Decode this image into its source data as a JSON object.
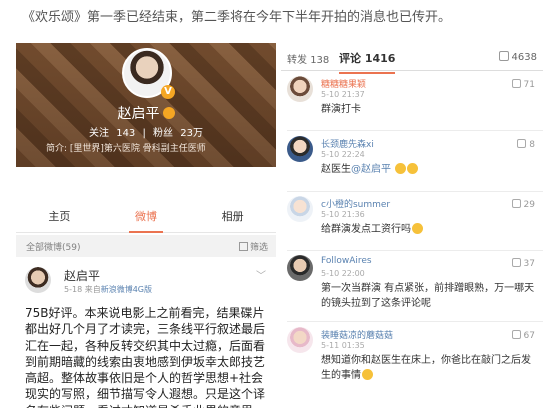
{
  "caption": "《欢乐颂》第一季已经结束，第二季将在今年下半年开拍的消息也已传开。",
  "profile": {
    "name": "赵启平",
    "stats": {
      "follow_label": "关注",
      "follow_value": "143",
      "fans_label": "粉丝",
      "fans_value": "23万"
    },
    "intro": "简介: [里世界]第六医院 骨科副主任医师",
    "colors": {
      "accent": "#eb7350",
      "badge": "#f5a623"
    }
  },
  "profile_tabs": [
    {
      "label": "主页"
    },
    {
      "label": "微博"
    },
    {
      "label": "相册"
    }
  ],
  "feed": {
    "count_label": "全部微博(59)",
    "filter_label": "筛选"
  },
  "post": {
    "author": "赵启平",
    "time": "5-18",
    "client_prefix": "来自",
    "client": "新浪微博4G版",
    "body": "75B好评。本来说电影上之前看完，结果碟片都出好几个月了才读完，三条线平行叙述最后汇在一起，各种反转交织其中太过瘾，后面看到前期暗藏的线索由衷地感到伊坂幸太郎技艺高超。整体故事依旧是个人的哲学思想+社会现实的写照，细节描写令人遐想。只是这个译名有些问题，看过才知道是杀手业界的意思"
  },
  "comment_tabs": {
    "repost_label": "转发",
    "repost_count": "138",
    "comment_label": "评论",
    "comment_count": "1416",
    "like_count": "4638"
  },
  "comments": [
    {
      "name": "糖糖糖果颖",
      "time": "5-10 21:37",
      "likes": "71",
      "text": "群演打卡"
    },
    {
      "name": "长颈鹿先森xi",
      "time": "5-10 22:24",
      "likes": "8",
      "text_prefix": "赵医生",
      "mention": "@赵启平"
    },
    {
      "name": "c小橙的summer",
      "time": "5-10 21:36",
      "likes": "29",
      "text": "给群演发点工资行吗"
    },
    {
      "name": "FollowAires",
      "time": "5-10 22:00",
      "likes": "37",
      "text": "第一次当群演 有点紧张，前排蹭眼熟，万一哪天的镜头拉到了这条评论呢"
    },
    {
      "name": "装睡菇凉的蘑菇菇",
      "time": "5-11 01:35",
      "likes": "67",
      "text": "想知道你和赵医生在床上，你爸比在敲门之后发生的事情"
    }
  ]
}
